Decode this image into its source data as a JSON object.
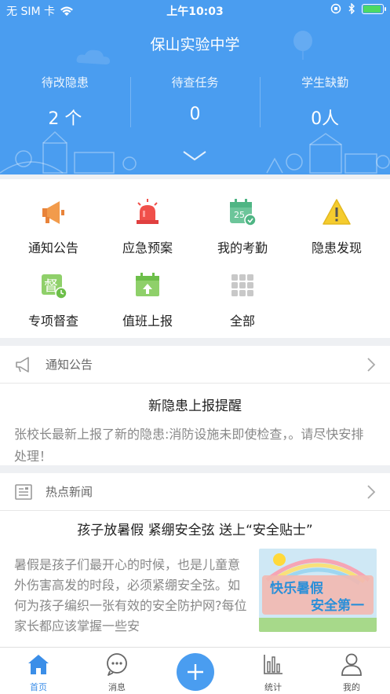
{
  "status_bar": {
    "carrier": "无 SIM 卡",
    "time": "上午10:03"
  },
  "header": {
    "title": "保山实验中学",
    "stats": [
      {
        "label": "待改隐患",
        "value": "2 个"
      },
      {
        "label": "待查任务",
        "value": "0"
      },
      {
        "label": "学生缺勤",
        "value": "0人"
      }
    ]
  },
  "grid": [
    {
      "label": "通知公告",
      "icon": "megaphone-icon"
    },
    {
      "label": "应急预案",
      "icon": "alarm-light-icon"
    },
    {
      "label": "我的考勤",
      "icon": "calendar-check-icon",
      "badge": "25"
    },
    {
      "label": "隐患发现",
      "icon": "warning-icon"
    },
    {
      "label": "专项督查",
      "icon": "supervise-icon",
      "badge": "督"
    },
    {
      "label": "值班上报",
      "icon": "duty-report-icon"
    },
    {
      "label": "全部",
      "icon": "all-grid-icon"
    }
  ],
  "notice": {
    "section": "通知公告",
    "title": "新隐患上报提醒",
    "body": "张校长最新上报了新的隐患:消防设施未即使检查，。请尽快安排处理！"
  },
  "news": {
    "section": "热点新闻",
    "title": "孩子放暑假 紧绷安全弦 送上“安全贴士”",
    "body": "暑假是孩子们最开心的时候，也是儿童意外伤害高发的时段，必须紧绷安全弦。如何为孩子编织一张有效的安全防护网?每位家长都应该掌握一些安",
    "image_text_1": "快乐暑假",
    "image_text_2": "安全第一"
  },
  "tabbar": [
    {
      "label": "首页",
      "icon": "home-icon",
      "active": true
    },
    {
      "label": "消息",
      "icon": "chat-icon"
    },
    {
      "label": "",
      "icon": "plus-icon"
    },
    {
      "label": "统计",
      "icon": "bar-chart-icon"
    },
    {
      "label": "我的",
      "icon": "user-icon"
    }
  ],
  "colors": {
    "primary": "#4a9df0",
    "active_tab": "#3b8ee8"
  }
}
